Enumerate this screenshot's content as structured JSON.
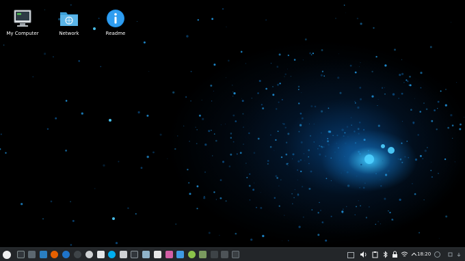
{
  "desktop": {
    "icons": [
      {
        "label": "My Computer",
        "icon": "computer-icon"
      },
      {
        "label": "Network",
        "icon": "network-folder-icon"
      },
      {
        "label": "Readme",
        "icon": "info-icon"
      }
    ]
  },
  "taskbar": {
    "launchers": [
      "app-menu-icon",
      "show-desktop-icon",
      "system-settings-icon",
      "mail-icon",
      "firefox-icon",
      "thunderbird-icon",
      "steam-icon",
      "obs-icon",
      "photos-icon",
      "skype-icon",
      "document-icon",
      "terminal-icon",
      "image-viewer-icon",
      "calendar-icon",
      "store-icon",
      "photo-manager-icon",
      "green-app-icon",
      "image-editor-icon",
      "files-icon",
      "window-icon",
      "media-icon"
    ],
    "tray": [
      "screen-icon",
      "volume-icon",
      "clipboard-icon",
      "bluetooth-icon",
      "lock-icon",
      "wifi-icon",
      "expand-tray-icon"
    ],
    "clock": "18:20"
  },
  "colors": {
    "accent": "#3daee9",
    "taskbar": "#232629"
  }
}
